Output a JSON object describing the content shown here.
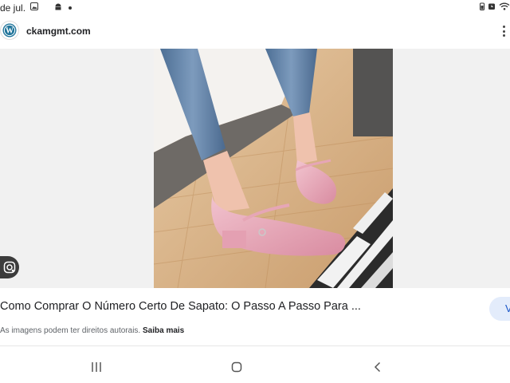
{
  "status_bar": {
    "time": "de jul."
  },
  "header": {
    "site_name": "ckamgmt.com"
  },
  "result": {
    "title": "Como Comprar O Número Certo De Sapato: O Passo A Passo Para ...",
    "copyright_text": "As imagens podem ter direitos autorais.",
    "learn_more": "Saiba mais",
    "visit_label": "V"
  },
  "icons": {
    "site_logo": "wordpress-icon",
    "lens": "google-lens-icon",
    "menu": "more-vert-icon",
    "nav_recents": "recents-icon",
    "nav_home": "home-icon",
    "nav_back": "back-icon"
  },
  "colors": {
    "accent": "#1a56c8",
    "visit_bg": "#e3ecfb",
    "image_backdrop": "#f1f1f1",
    "shoe_pink": "#e9a7b7"
  }
}
